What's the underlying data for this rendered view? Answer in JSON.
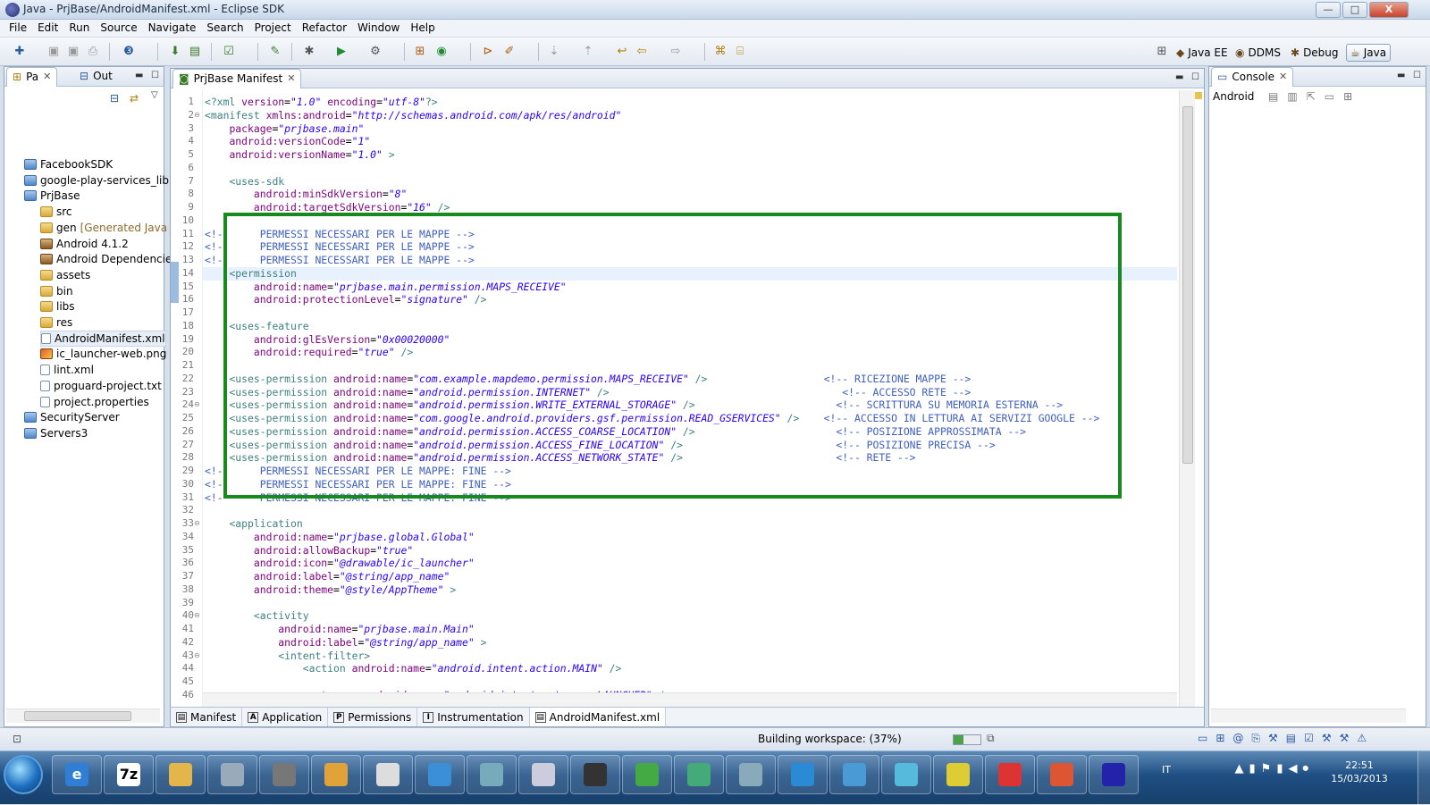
{
  "window": {
    "title": "Java - PrjBase/AndroidManifest.xml - Eclipse SDK",
    "min_label": "—",
    "max_label": "□",
    "close_label": "X"
  },
  "menu": [
    "File",
    "Edit",
    "Run",
    "Source",
    "Navigate",
    "Search",
    "Project",
    "Refactor",
    "Window",
    "Help"
  ],
  "perspectives": {
    "java_ee": "Java EE",
    "ddms": "DDMS",
    "debug": "Debug",
    "java": "Java"
  },
  "left_panel": {
    "tabs": [
      {
        "label": "Pa"
      },
      {
        "label": "Out"
      }
    ],
    "tree": [
      {
        "label": "FacebookSDK",
        "icon": "project",
        "indent": 0
      },
      {
        "label": "google-play-services_lib",
        "icon": "project",
        "indent": 0
      },
      {
        "label": "PrjBase",
        "icon": "project",
        "indent": 0
      },
      {
        "label": "src",
        "icon": "folder",
        "indent": 1
      },
      {
        "label": "gen",
        "suffix": " [Generated Java F",
        "icon": "folder",
        "indent": 1
      },
      {
        "label": "Android 4.1.2",
        "icon": "lib",
        "indent": 1
      },
      {
        "label": "Android Dependencie",
        "icon": "lib",
        "indent": 1
      },
      {
        "label": "assets",
        "icon": "folder",
        "indent": 1
      },
      {
        "label": "bin",
        "icon": "folder",
        "indent": 1
      },
      {
        "label": "libs",
        "icon": "folder",
        "indent": 1
      },
      {
        "label": "res",
        "icon": "folder",
        "indent": 1
      },
      {
        "label": "AndroidManifest.xml",
        "icon": "file",
        "indent": 1,
        "selected": true
      },
      {
        "label": "ic_launcher-web.png",
        "icon": "img",
        "indent": 1
      },
      {
        "label": "lint.xml",
        "icon": "file",
        "indent": 1
      },
      {
        "label": "proguard-project.txt",
        "icon": "file",
        "indent": 1
      },
      {
        "label": "project.properties",
        "icon": "file",
        "indent": 1
      },
      {
        "label": "SecurityServer",
        "icon": "project",
        "indent": 0
      },
      {
        "label": "Servers3",
        "icon": "project",
        "indent": 0
      }
    ]
  },
  "editor": {
    "tab_label": "PrjBase Manifest",
    "lines": [
      [
        [
          "t",
          "<?xml "
        ],
        [
          "a",
          "version"
        ],
        [
          "p",
          "="
        ],
        [
          "v",
          "\"1.0\""
        ],
        [
          "p",
          " "
        ],
        [
          "a",
          "encoding"
        ],
        [
          "p",
          "="
        ],
        [
          "v",
          "\"utf-8\""
        ],
        [
          "t",
          "?>"
        ]
      ],
      [
        [
          "t",
          "<manifest "
        ],
        [
          "a",
          "xmlns:android"
        ],
        [
          "p",
          "="
        ],
        [
          "v",
          "\"http://schemas.android.com/apk/res/android\""
        ]
      ],
      [
        [
          "p",
          "    "
        ],
        [
          "a",
          "package"
        ],
        [
          "p",
          "="
        ],
        [
          "v",
          "\"prjbase.main\""
        ]
      ],
      [
        [
          "p",
          "    "
        ],
        [
          "a",
          "android:versionCode"
        ],
        [
          "p",
          "="
        ],
        [
          "v",
          "\"1\""
        ]
      ],
      [
        [
          "p",
          "    "
        ],
        [
          "a",
          "android:versionName"
        ],
        [
          "p",
          "="
        ],
        [
          "v",
          "\"1.0\""
        ],
        [
          "t",
          " >"
        ]
      ],
      [],
      [
        [
          "p",
          "    "
        ],
        [
          "t",
          "<uses-sdk"
        ]
      ],
      [
        [
          "p",
          "        "
        ],
        [
          "a",
          "android:minSdkVersion"
        ],
        [
          "p",
          "="
        ],
        [
          "v",
          "\"8\""
        ]
      ],
      [
        [
          "p",
          "        "
        ],
        [
          "a",
          "android:targetSdkVersion"
        ],
        [
          "p",
          "="
        ],
        [
          "v",
          "\"16\""
        ],
        [
          "t",
          " />"
        ]
      ],
      [],
      [
        [
          "c",
          "<!-      PERMESSI NECESSARI PER LE MAPPE -->"
        ]
      ],
      [
        [
          "c",
          "<!-      PERMESSI NECESSARI PER LE MAPPE -->"
        ]
      ],
      [
        [
          "c",
          "<!-      PERMESSI NECESSARI PER LE MAPPE -->"
        ]
      ],
      [
        [
          "p",
          "    "
        ],
        [
          "t",
          "<permission"
        ]
      ],
      [
        [
          "p",
          "        "
        ],
        [
          "a",
          "android:name"
        ],
        [
          "p",
          "="
        ],
        [
          "v",
          "\"prjbase.main.permission.MAPS_RECEIVE\""
        ]
      ],
      [
        [
          "p",
          "        "
        ],
        [
          "a",
          "android:protectionLevel"
        ],
        [
          "p",
          "="
        ],
        [
          "v",
          "\"signature\""
        ],
        [
          "t",
          " />"
        ]
      ],
      [],
      [
        [
          "p",
          "    "
        ],
        [
          "t",
          "<uses-feature"
        ]
      ],
      [
        [
          "p",
          "        "
        ],
        [
          "a",
          "android:glEsVersion"
        ],
        [
          "p",
          "="
        ],
        [
          "v",
          "\"0x00020000\""
        ]
      ],
      [
        [
          "p",
          "        "
        ],
        [
          "a",
          "android:required"
        ],
        [
          "p",
          "="
        ],
        [
          "v",
          "\"true\""
        ],
        [
          "t",
          " />"
        ]
      ],
      [],
      [
        [
          "p",
          "    "
        ],
        [
          "t",
          "<uses-permission "
        ],
        [
          "a",
          "android:name"
        ],
        [
          "p",
          "="
        ],
        [
          "v",
          "\"com.example.mapdemo.permission.MAPS_RECEIVE\""
        ],
        [
          "t",
          " />"
        ],
        [
          "p",
          "                   "
        ],
        [
          "c",
          "<!-- RICEZIONE MAPPE -->"
        ]
      ],
      [
        [
          "p",
          "    "
        ],
        [
          "t",
          "<uses-permission "
        ],
        [
          "a",
          "android:name"
        ],
        [
          "p",
          "="
        ],
        [
          "v",
          "\"android.permission.INTERNET\""
        ],
        [
          "t",
          " />"
        ],
        [
          "p",
          "                                      "
        ],
        [
          "c",
          "<!-- ACCESSO RETE -->"
        ]
      ],
      [
        [
          "p",
          "    "
        ],
        [
          "t",
          "<uses-permission "
        ],
        [
          "a",
          "android:name"
        ],
        [
          "p",
          "="
        ],
        [
          "v",
          "\"android.permission.WRITE_EXTERNAL_STORAGE\""
        ],
        [
          "t",
          " />"
        ],
        [
          "p",
          "                       "
        ],
        [
          "c",
          "<!-- SCRITTURA SU MEMORIA ESTERNA -->"
        ]
      ],
      [
        [
          "p",
          "    "
        ],
        [
          "t",
          "<uses-permission "
        ],
        [
          "a",
          "android:name"
        ],
        [
          "p",
          "="
        ],
        [
          "v",
          "\"com.google.android.providers.gsf.permission.READ_GSERVICES\""
        ],
        [
          "t",
          " />"
        ],
        [
          "p",
          "    "
        ],
        [
          "c",
          "<!-- ACCESSO IN LETTURA AI SERVIZI GOOGLE -->"
        ]
      ],
      [
        [
          "p",
          "    "
        ],
        [
          "t",
          "<uses-permission "
        ],
        [
          "a",
          "android:name"
        ],
        [
          "p",
          "="
        ],
        [
          "v",
          "\"android.permission.ACCESS_COARSE_LOCATION\""
        ],
        [
          "t",
          " />"
        ],
        [
          "p",
          "                       "
        ],
        [
          "c",
          "<!-- POSIZIONE APPROSSIMATA -->"
        ]
      ],
      [
        [
          "p",
          "    "
        ],
        [
          "t",
          "<uses-permission "
        ],
        [
          "a",
          "android:name"
        ],
        [
          "p",
          "="
        ],
        [
          "v",
          "\"android.permission.ACCESS_FINE_LOCATION\""
        ],
        [
          "t",
          " />"
        ],
        [
          "p",
          "                         "
        ],
        [
          "c",
          "<!-- POSIZIONE PRECISA -->"
        ]
      ],
      [
        [
          "p",
          "    "
        ],
        [
          "t",
          "<uses-permission "
        ],
        [
          "a",
          "android:name"
        ],
        [
          "p",
          "="
        ],
        [
          "v",
          "\"android.permission.ACCESS_NETWORK_STATE\""
        ],
        [
          "t",
          " />"
        ],
        [
          "p",
          "                         "
        ],
        [
          "c",
          "<!-- RETE -->"
        ]
      ],
      [
        [
          "c",
          "<!-      PERMESSI NECESSARI PER LE MAPPE: FINE -->"
        ]
      ],
      [
        [
          "c",
          "<!-      PERMESSI NECESSARI PER LE MAPPE: FINE -->"
        ]
      ],
      [
        [
          "c",
          "<!-      PERMESSI NECESSARI PER LE MAPPE: FINE -->"
        ]
      ],
      [],
      [
        [
          "p",
          "    "
        ],
        [
          "t",
          "<application"
        ]
      ],
      [
        [
          "p",
          "        "
        ],
        [
          "a",
          "android:name"
        ],
        [
          "p",
          "="
        ],
        [
          "v",
          "\"prjbase.global.Global\""
        ]
      ],
      [
        [
          "p",
          "        "
        ],
        [
          "a",
          "android:allowBackup"
        ],
        [
          "p",
          "="
        ],
        [
          "v",
          "\"true\""
        ]
      ],
      [
        [
          "p",
          "        "
        ],
        [
          "a",
          "android:icon"
        ],
        [
          "p",
          "="
        ],
        [
          "v",
          "\"@drawable/ic_launcher\""
        ]
      ],
      [
        [
          "p",
          "        "
        ],
        [
          "a",
          "android:label"
        ],
        [
          "p",
          "="
        ],
        [
          "v",
          "\"@string/app_name\""
        ]
      ],
      [
        [
          "p",
          "        "
        ],
        [
          "a",
          "android:theme"
        ],
        [
          "p",
          "="
        ],
        [
          "v",
          "\"@style/AppTheme\""
        ],
        [
          "t",
          " >"
        ]
      ],
      [],
      [
        [
          "p",
          "        "
        ],
        [
          "t",
          "<activity"
        ]
      ],
      [
        [
          "p",
          "            "
        ],
        [
          "a",
          "android:name"
        ],
        [
          "p",
          "="
        ],
        [
          "v",
          "\"prjbase.main.Main\""
        ]
      ],
      [
        [
          "p",
          "            "
        ],
        [
          "a",
          "android:label"
        ],
        [
          "p",
          "="
        ],
        [
          "v",
          "\"@string/app_name\""
        ],
        [
          "t",
          " >"
        ]
      ],
      [
        [
          "p",
          "            "
        ],
        [
          "t",
          "<intent-filter>"
        ]
      ],
      [
        [
          "p",
          "                "
        ],
        [
          "t",
          "<action "
        ],
        [
          "a",
          "android:name"
        ],
        [
          "p",
          "="
        ],
        [
          "v",
          "\"android.intent.action.MAIN\""
        ],
        [
          "t",
          " />"
        ]
      ],
      [],
      [
        [
          "p",
          "                "
        ],
        [
          "t",
          "<category "
        ],
        [
          "a",
          "android:name"
        ],
        [
          "p",
          "="
        ],
        [
          "v",
          "\"android.intent.category.LAUNCHER\""
        ],
        [
          "t",
          " />"
        ]
      ]
    ],
    "fold_lines": [
      2,
      24,
      33,
      40,
      43
    ],
    "bottom_tabs": [
      {
        "label": "Manifest",
        "icon": "▤"
      },
      {
        "label": "Application",
        "icon": "A"
      },
      {
        "label": "Permissions",
        "icon": "P"
      },
      {
        "label": "Instrumentation",
        "icon": "I"
      },
      {
        "label": "AndroidManifest.xml",
        "icon": "▤",
        "active": true
      }
    ]
  },
  "console": {
    "tab_label": "Console",
    "content": "Android"
  },
  "status": {
    "text": "Building workspace: (37%)",
    "progress": 0.37
  },
  "taskbar": {
    "clock_time": "22:51",
    "clock_date": "15/03/2013",
    "lang": "IT",
    "apps": [
      "e",
      "7z",
      "",
      "",
      "",
      "",
      "",
      "",
      "",
      "",
      "",
      "",
      "",
      "",
      "",
      "",
      "",
      "",
      "",
      "",
      ""
    ]
  },
  "colors": {
    "highlight_box": "#178a1e",
    "tag": "#3f7f7f",
    "attr": "#7f007f",
    "value": "#2a00ff",
    "comment": "#3f5fbf"
  }
}
